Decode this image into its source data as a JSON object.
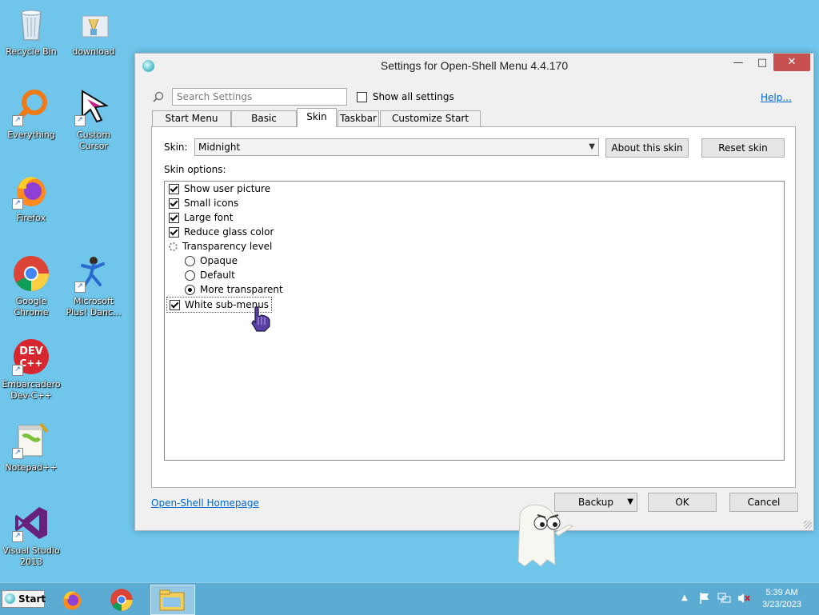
{
  "desktop": {
    "icons": [
      {
        "label": "Recycle Bin"
      },
      {
        "label": "download"
      },
      {
        "label": "Everything"
      },
      {
        "label": "Custom Cursor"
      },
      {
        "label": "Firefox"
      },
      {
        "label": "Google Chrome"
      },
      {
        "label": "Microsoft Plus! Danc..."
      },
      {
        "label": "Embarcadero Dev-C++"
      },
      {
        "label": "Notepad++"
      },
      {
        "label": "Visual Studio 2013"
      }
    ],
    "background_color": "#6fc6ea"
  },
  "window": {
    "title": "Settings for Open-Shell Menu 4.4.170",
    "controls": {
      "minimize": "—",
      "maximize": "□",
      "close": "✕"
    },
    "search": {
      "placeholder": "Search Settings",
      "value": ""
    },
    "show_all_settings": {
      "label": "Show all settings",
      "checked": false
    },
    "help_link": "Help...",
    "tabs": [
      {
        "label": "Start Menu Style",
        "active": false
      },
      {
        "label": "Basic Settings",
        "active": false
      },
      {
        "label": "Skin",
        "active": true
      },
      {
        "label": "Taskbar",
        "active": false
      },
      {
        "label": "Customize Start Menu",
        "active": false
      }
    ],
    "skin": {
      "label": "Skin:",
      "selected": "Midnight",
      "about_button": "About this skin",
      "reset_button": "Reset skin",
      "options_label": "Skin options:",
      "options": [
        {
          "type": "checkbox",
          "label": "Show user picture",
          "checked": true
        },
        {
          "type": "checkbox",
          "label": "Small icons",
          "checked": true
        },
        {
          "type": "checkbox",
          "label": "Large font",
          "checked": true
        },
        {
          "type": "checkbox",
          "label": "Reduce glass color",
          "checked": true
        },
        {
          "type": "group",
          "label": "Transparency level"
        },
        {
          "type": "radio",
          "label": "Opaque",
          "checked": false
        },
        {
          "type": "radio",
          "label": "Default",
          "checked": false
        },
        {
          "type": "radio",
          "label": "More transparent",
          "checked": true
        },
        {
          "type": "checkbox",
          "label": "White sub-menus",
          "checked": true
        }
      ]
    },
    "footer": {
      "homepage_link": "Open-Shell Homepage",
      "backup_button": "Backup",
      "ok_button": "OK",
      "cancel_button": "Cancel"
    }
  },
  "taskbar": {
    "start_label": "Start",
    "clock_time": "5:39 AM",
    "clock_date": "3/23/2023"
  },
  "accent_colors": {
    "taskbar": "#5cabd3",
    "link": "#0066cc",
    "close_button": "#c75050"
  }
}
